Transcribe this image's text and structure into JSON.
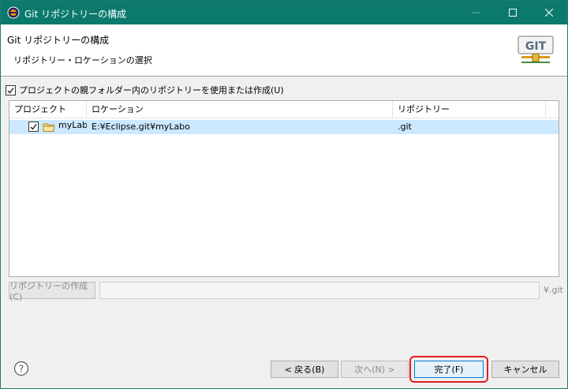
{
  "window": {
    "title": "Git リポジトリーの構成"
  },
  "banner": {
    "title": "Git リポジトリーの構成",
    "subtitle": "リポジトリー・ロケーションの選択",
    "logo_text": "GIT"
  },
  "options": {
    "use_parent_label": "プロジェクトの親フォルダー内のリポジトリーを使用または作成(U)",
    "use_parent_checked": true
  },
  "table": {
    "headers": [
      "プロジェクト",
      "ロケーション",
      "リポジトリー"
    ],
    "rows": [
      {
        "project": "myLabo",
        "location": "E:¥Eclipse.git¥myLabo",
        "repository": ".git",
        "checked": true
      }
    ]
  },
  "create": {
    "button_label": "リポジトリーの作成(C)",
    "path_value": "",
    "suffix": "¥.git"
  },
  "buttons": {
    "back": "< 戻る(B)",
    "next": "次へ(N) >",
    "finish": "完了(F)",
    "cancel": "キャンセル"
  },
  "colors": {
    "titlebar": "#0b7a6c",
    "selection": "#cce8ff",
    "highlight_ring": "#e51c1c"
  }
}
